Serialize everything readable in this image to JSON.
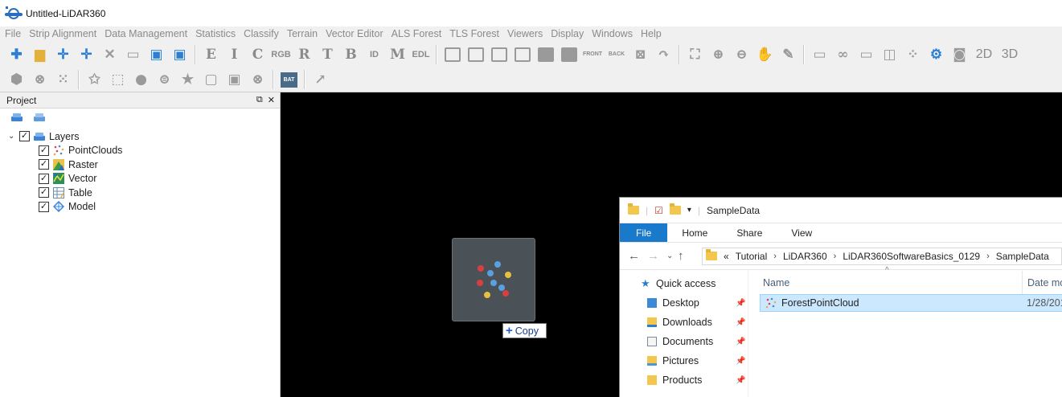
{
  "window": {
    "title": "Untitled-LiDAR360"
  },
  "menu": [
    "File",
    "Strip Alignment",
    "Data Management",
    "Statistics",
    "Classify",
    "Terrain",
    "Vector Editor",
    "ALS Forest",
    "TLS Forest",
    "Viewers",
    "Display",
    "Windows",
    "Help"
  ],
  "toolbar": {
    "letters": [
      "E",
      "I",
      "C",
      "R",
      "T",
      "B",
      "ID",
      "M",
      "EDL"
    ],
    "rgb_label": "RGB",
    "view_front": "FRONT",
    "view_back": "BACK",
    "mode_2d": "2D",
    "mode_3d": "3D",
    "bat_label": "BAT"
  },
  "project": {
    "header": "Project",
    "root": {
      "label": "Layers",
      "checked": true,
      "expanded": true
    },
    "layers": [
      {
        "label": "PointClouds",
        "icon": "pointcloud-icon"
      },
      {
        "label": "Raster",
        "icon": "raster-icon"
      },
      {
        "label": "Vector",
        "icon": "vector-icon"
      },
      {
        "label": "Table",
        "icon": "table-icon"
      },
      {
        "label": "Model",
        "icon": "model-icon"
      }
    ]
  },
  "drag": {
    "tooltip": "Copy"
  },
  "explorer": {
    "title": "SampleData",
    "ribbon_tabs": [
      "File",
      "Home",
      "Share",
      "View"
    ],
    "breadcrumb": [
      "Tutorial",
      "LiDAR360",
      "LiDAR360SoftwareBasics_0129",
      "SampleData"
    ],
    "breadcrumb_prefix": "«",
    "nav": [
      {
        "label": "Quick access",
        "pinned": false
      },
      {
        "label": "Desktop",
        "pinned": true
      },
      {
        "label": "Downloads",
        "pinned": true
      },
      {
        "label": "Documents",
        "pinned": true
      },
      {
        "label": "Pictures",
        "pinned": true
      },
      {
        "label": "Products",
        "pinned": true
      }
    ],
    "columns": {
      "name": "Name",
      "date": "Date mo"
    },
    "files": [
      {
        "name": "ForestPointCloud",
        "date": "1/28/201"
      }
    ]
  },
  "colors": {
    "accent": "#1979ca",
    "selection": "#cce8ff",
    "canvas": "#000000"
  }
}
